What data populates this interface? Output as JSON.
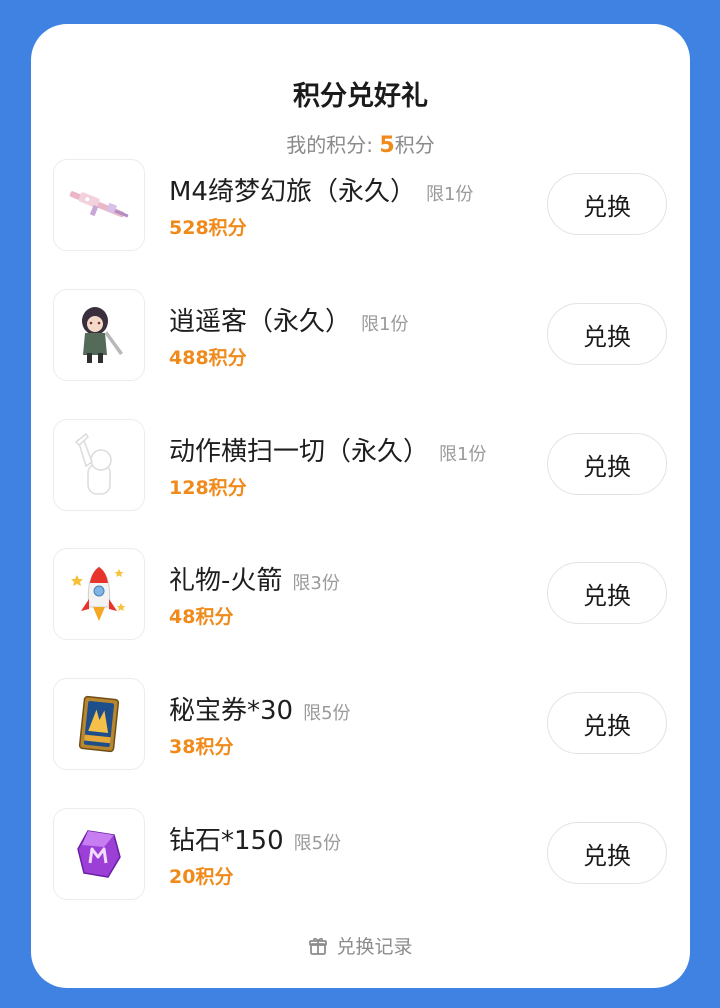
{
  "header": {
    "title": "积分兑好礼",
    "points_prefix": "我的积分: ",
    "points_value": "5",
    "points_suffix": "积分"
  },
  "items": [
    {
      "name": "M4绮梦幻旅（永久）",
      "limit": "限1份",
      "cost": "528积分",
      "button": "兑换",
      "icon": "pink-rifle-icon"
    },
    {
      "name": "逍遥客（永久）",
      "limit": "限1份",
      "cost": "488积分",
      "button": "兑换",
      "icon": "character-icon"
    },
    {
      "name": "动作横扫一切（永久）",
      "limit": "限1份",
      "cost": "128积分",
      "button": "兑换",
      "icon": "action-pose-icon"
    },
    {
      "name": "礼物-火箭",
      "limit": "限3份",
      "cost": "48积分",
      "button": "兑换",
      "icon": "rocket-icon"
    },
    {
      "name": "秘宝券*30",
      "limit": "限5份",
      "cost": "38积分",
      "button": "兑换",
      "icon": "treasure-ticket-icon"
    },
    {
      "name": "钻石*150",
      "limit": "限5份",
      "cost": "20积分",
      "button": "兑换",
      "icon": "purple-diamond-icon"
    }
  ],
  "footer": {
    "label": "兑换记录",
    "icon": "gift-box-icon"
  },
  "colors": {
    "background": "#3f82e2",
    "accent": "#f08a1a",
    "card": "#ffffff"
  }
}
